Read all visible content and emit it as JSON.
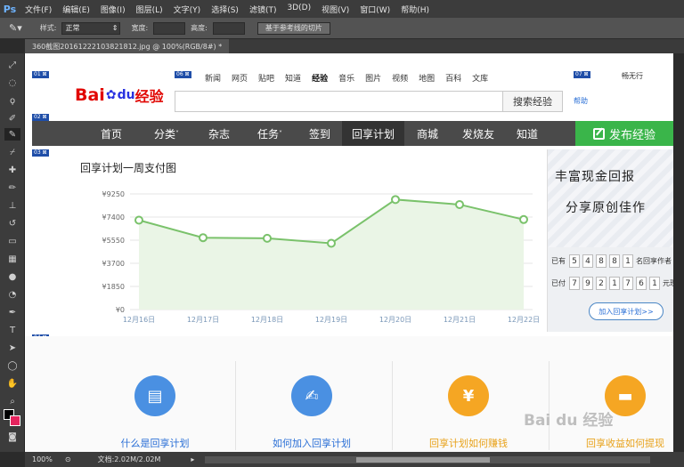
{
  "app": {
    "logo": "Ps",
    "menus": [
      "文件(F)",
      "编辑(E)",
      "图像(I)",
      "图层(L)",
      "文字(Y)",
      "选择(S)",
      "滤镜(T)",
      "3D(D)",
      "视图(V)",
      "窗口(W)",
      "帮助(H)"
    ],
    "options": {
      "style_label": "样式:",
      "style_value": "正常",
      "width_label": "宽度:",
      "height_label": "高度:",
      "slice_button": "基于参考线的切片"
    },
    "document_tab": "360截图20161222103821812.jpg @ 100%(RGB/8#) *",
    "status": {
      "zoom": "100%",
      "doc_size": "文档:2.02M/2.02M"
    }
  },
  "page": {
    "top_nav": [
      "新闻",
      "网页",
      "贴吧",
      "知道",
      "经验",
      "音乐",
      "图片",
      "视频",
      "地图",
      "百科",
      "文库"
    ],
    "top_nav_active": "经验",
    "user": "畅无行",
    "logo_text_a": "Bai",
    "logo_text_b": "du",
    "logo_text_c": "经验",
    "search_button": "搜索经验",
    "help": "帮助",
    "main_nav": [
      "首页",
      "分类",
      "杂志",
      "任务",
      "签到",
      "回享计划",
      "商城",
      "发烧友",
      "知道"
    ],
    "main_nav_active": "回享计划",
    "publish": "发布经验",
    "promo": {
      "headline1": "丰富现金回报",
      "headline2": "分享原创佳作",
      "row1_prefix": "已有",
      "row1_digits": [
        "5",
        "4",
        "8",
        "8",
        "1"
      ],
      "row1_suffix": "名回享作者",
      "row2_prefix": "已付",
      "row2_digits": [
        "7",
        "9",
        "2",
        "1",
        "7",
        "6",
        "1"
      ],
      "row2_suffix": "元现金",
      "button": "加入回享计划>>"
    },
    "cards": [
      {
        "label": "什么是回享计划",
        "icon": "book-icon",
        "color": "#4a90e2",
        "label_color": "#2a6fd6"
      },
      {
        "label": "如何加入回享计划",
        "icon": "edit-doc-icon",
        "color": "#4a90e2",
        "label_color": "#2a6fd6"
      },
      {
        "label": "回享计划如何赚钱",
        "icon": "money-bag-icon",
        "color": "#f5a623",
        "label_color": "#e8a21a"
      },
      {
        "label": "回享收益如何提现",
        "icon": "cash-icon",
        "color": "#f5a623",
        "label_color": "#e8a21a"
      }
    ],
    "watermark": "Bai du 经验"
  },
  "chart_data": {
    "type": "area",
    "title": "回享计划一周支付图",
    "categories": [
      "12月16日",
      "12月17日",
      "12月18日",
      "12月19日",
      "12月20日",
      "12月21日",
      "12月22日"
    ],
    "values": [
      7150,
      5750,
      5700,
      5300,
      8800,
      8400,
      7200
    ],
    "yticks": [
      "¥0",
      "¥1850",
      "¥3700",
      "¥5550",
      "¥7400",
      "¥9250"
    ],
    "ylim": [
      0,
      9250
    ],
    "grid": true,
    "line_color": "#7ac26b",
    "fill_color": "#eaf5e6"
  }
}
